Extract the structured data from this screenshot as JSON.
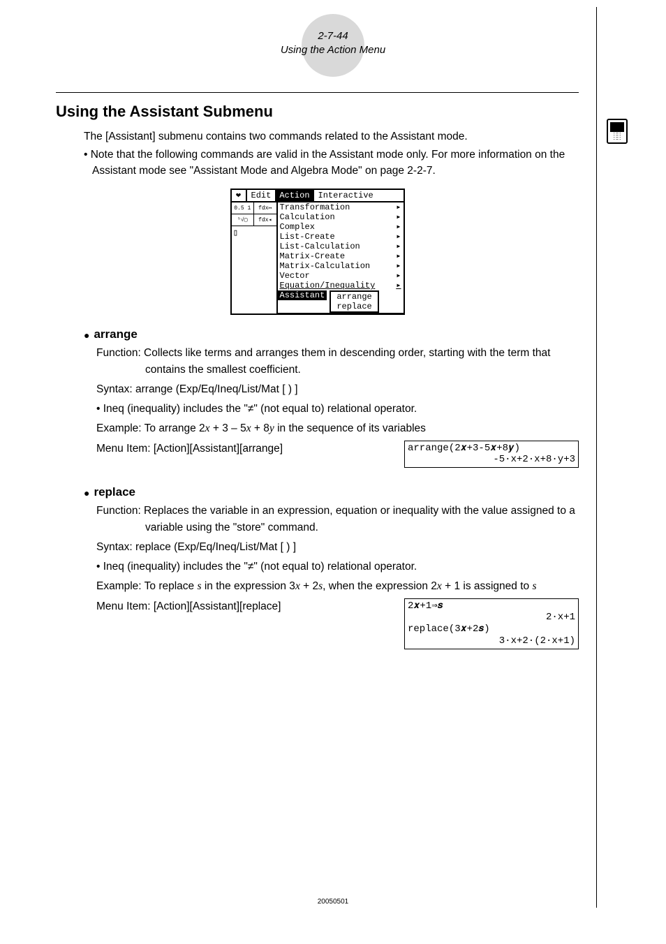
{
  "header": {
    "page_ref": "2-7-44",
    "section_title": "Using the Action Menu"
  },
  "heading": "Using the Assistant Submenu",
  "intro": {
    "line1": "The [Assistant] submenu contains two commands related to the Assistant mode.",
    "note": "• Note that the following commands are valid in the Assistant mode only. For more information on the Assistant mode see \"Assistant Mode and Algebra Mode\" on page 2-2-7."
  },
  "calc_screenshot": {
    "menubar": {
      "edit": "Edit",
      "action": "Action",
      "interactive": "Interactive"
    },
    "menu_items": [
      "Transformation",
      "Calculation",
      "Complex",
      "List-Create",
      "List-Calculation",
      "Matrix-Create",
      "Matrix-Calculation",
      "Vector",
      "Equation/Inequality"
    ],
    "highlighted_item": "Assistant",
    "sub_items": [
      "arrange",
      "replace"
    ]
  },
  "arrange": {
    "title": "arrange",
    "function": "Function: Collects like terms and arranges them in descending order, starting with the term that contains the smallest coefficient.",
    "syntax": "Syntax: arrange (Exp/Eq/Ineq/List/Mat [ ) ]",
    "ineq_note": "• Ineq (inequality) includes the \"≠\" (not equal to) relational operator.",
    "example_prefix": "Example: To arrange 2",
    "example_mid1": " + 3 – 5",
    "example_mid2": " + 8",
    "example_suffix": " in the sequence of its variables",
    "menuitem": "Menu Item: [Action][Assistant][arrange]",
    "result": {
      "line1": "arrange(2𝒙+3-5𝒙+8𝒚)",
      "line2": "-5·x+2·x+8·y+3"
    }
  },
  "replace": {
    "title": "replace",
    "function": "Function: Replaces the variable in an expression, equation or inequality with the value assigned to a variable using the \"store\" command.",
    "syntax": "Syntax: replace (Exp/Eq/Ineq/List/Mat [ ) ]",
    "ineq_note": "• Ineq (inequality) includes the \"≠\" (not equal to) relational operator.",
    "example_prefix": "Example: To replace ",
    "example_mid1": " in the expression 3",
    "example_mid2": " + 2",
    "example_mid3": ", when the expression 2",
    "example_mid4": " + 1 is assigned to ",
    "menuitem": "Menu Item: [Action][Assistant][replace]",
    "result": {
      "line1": "2𝒙+1⇒𝒔",
      "line2": "2·x+1",
      "line3": "replace(3𝒙+2𝒔)",
      "line4": "3·x+2·(2·x+1)"
    }
  },
  "footer": "20050501"
}
